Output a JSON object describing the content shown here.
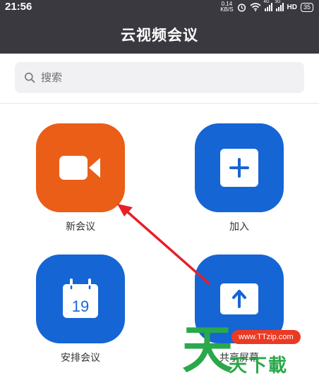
{
  "status_bar": {
    "time": "21:56",
    "net_speed_value": "0.14",
    "net_speed_unit": "KB/S",
    "signal1_label": "4G",
    "signal2_label": "3G",
    "hd_label": "HD",
    "battery": "35"
  },
  "header": {
    "title": "云视频会议"
  },
  "search": {
    "placeholder": "搜索"
  },
  "actions": [
    {
      "label": "新会议",
      "icon": "video-camera-icon",
      "color": "#ea5e17"
    },
    {
      "label": "加入",
      "icon": "plus-icon",
      "color": "#1565d5"
    },
    {
      "label": "安排会议",
      "icon": "calendar-icon",
      "color": "#1565d5",
      "calendar_day": "19"
    },
    {
      "label": "共享屏幕",
      "icon": "share-up-arrow-icon",
      "color": "#1565d5"
    }
  ],
  "annotation": {
    "arrow_color": "#e5202a"
  },
  "watermark": {
    "sky_char": "天",
    "url": "www.TTzip.com",
    "text": "天下載"
  }
}
